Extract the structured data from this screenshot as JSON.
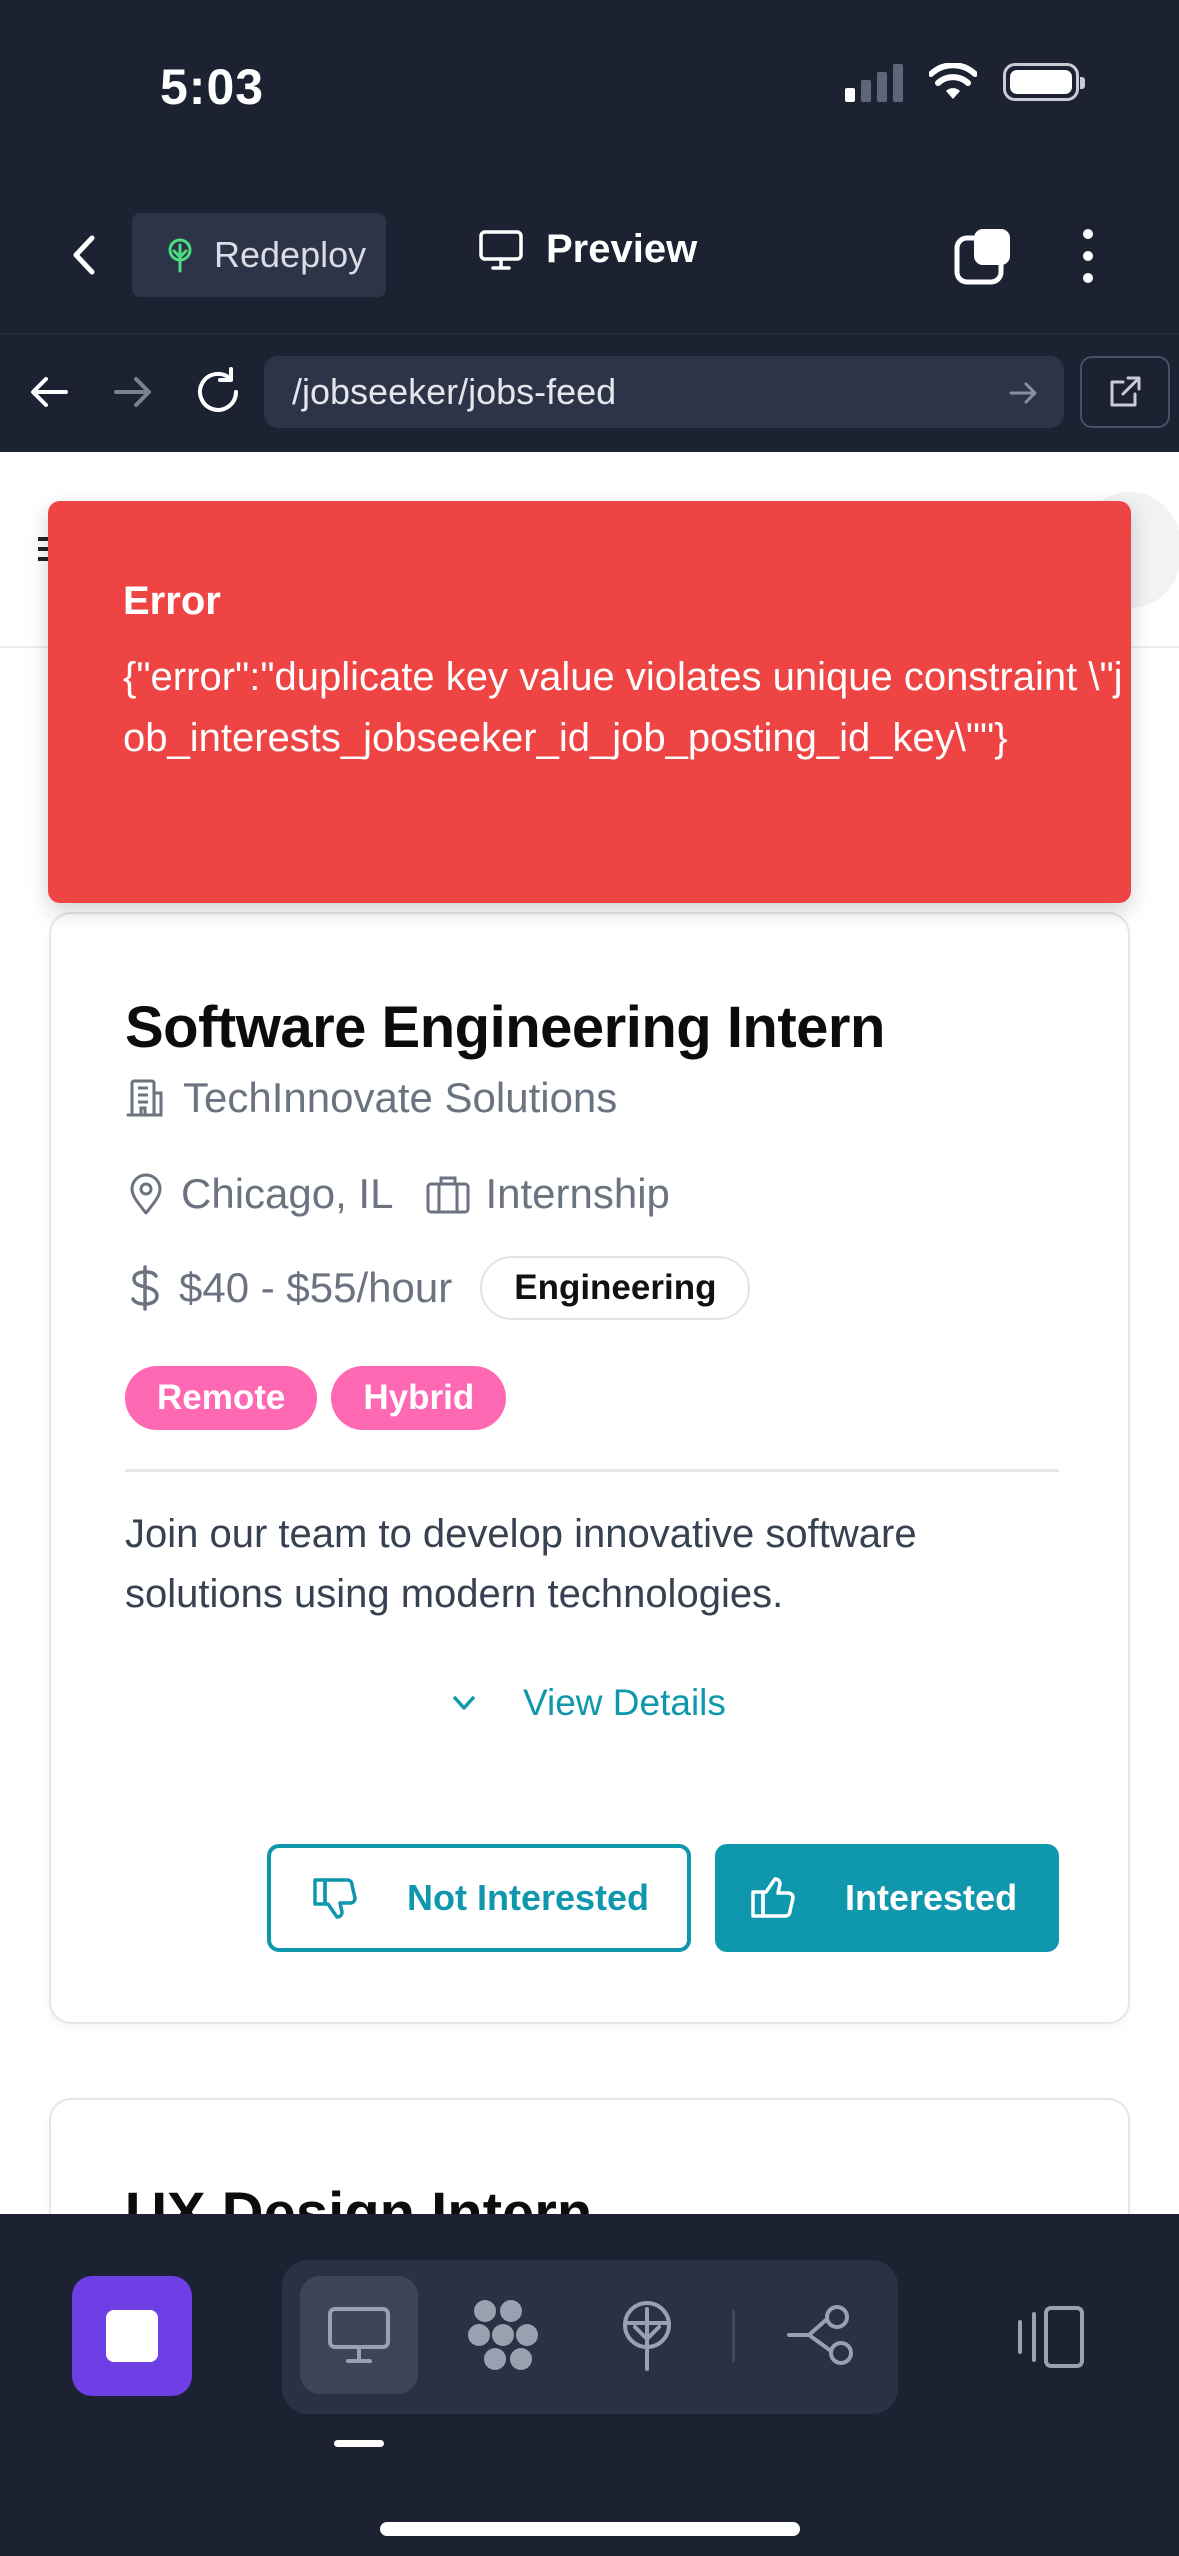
{
  "status_bar": {
    "time": "5:03"
  },
  "app_bar": {
    "redeploy_label": "Redeploy",
    "preview_label": "Preview"
  },
  "url_bar": {
    "path": "/jobseeker/jobs-feed"
  },
  "toast": {
    "title": "Error",
    "message": "{\"error\":\"duplicate key value violates unique constraint \\\"job_interests_jobseeker_id_job_posting_id_key\\\"\"}"
  },
  "jobs": [
    {
      "title": "Software Engineering Intern",
      "company": "TechInnovate Solutions",
      "location": "Chicago, IL",
      "job_type": "Internship",
      "pay": "$40 - $55/hour",
      "category": "Engineering",
      "tags": [
        "Remote",
        "Hybrid"
      ],
      "description": "Join our team to develop innovative software solutions using modern technologies.",
      "details_label": "View Details",
      "not_interested_label": "Not Interested",
      "interested_label": "Interested"
    },
    {
      "title": "UX Design Intern"
    }
  ],
  "colors": {
    "chrome_dark": "#1d2233",
    "accent_teal": "#0f97ad",
    "error_red": "#ef4444",
    "tag_pink": "#ff69b4",
    "stop_purple": "#6d3fe4"
  },
  "icons": {
    "back": "chevron-left-icon",
    "redeploy": "tree-icon",
    "preview": "monitor-icon",
    "tabs": "tabs-icon",
    "more": "more-vertical-icon",
    "company": "building-icon",
    "location": "map-pin-icon",
    "job_type": "briefcase-icon",
    "pay": "dollar-icon",
    "details": "chevron-down-icon",
    "not_interested": "thumbs-down-icon",
    "interested": "thumbs-up-icon"
  }
}
